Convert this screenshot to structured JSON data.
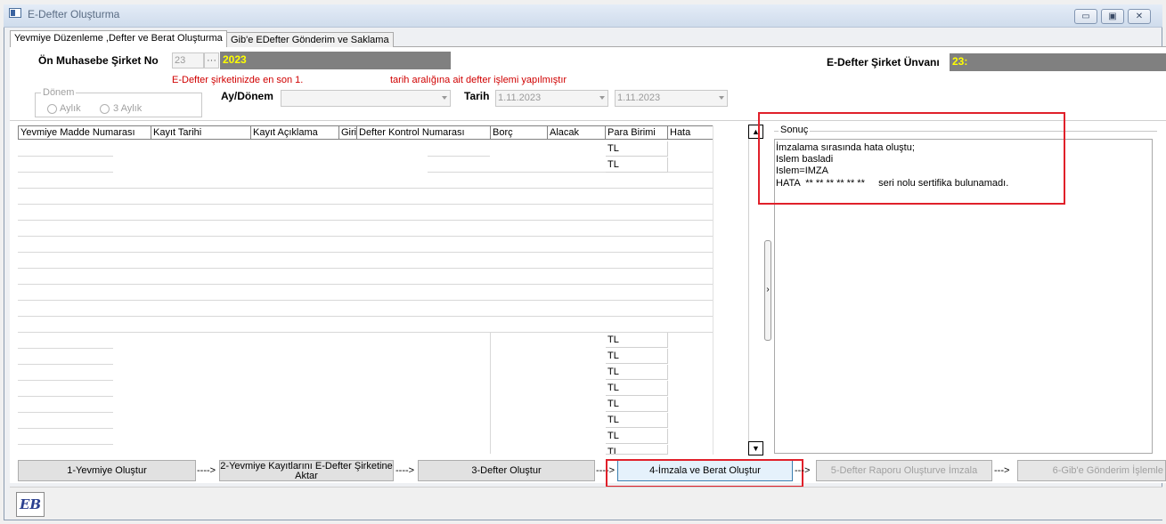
{
  "window": {
    "title": "E-Defter Oluşturma",
    "minimize": "▭",
    "maximize": "▣",
    "close": "✕"
  },
  "tabs": [
    {
      "label": "Yevmiye Düzenleme ,Defter ve Berat Oluşturma"
    },
    {
      "label": "Gib'e EDefter Gönderim ve Saklama"
    }
  ],
  "form": {
    "company_label": "Ön Muhasebe Şirket No",
    "company_no": "23",
    "browse": "···",
    "company_year": "2023",
    "edefter_company_label": "E-Defter Şirket Ünvanı",
    "edefter_company_value": "23:",
    "notice_left": "E-Defter şirketinizde en son 1.",
    "notice_right": "tarih aralığına ait defter işlemi yapılmıştır",
    "period_group": "Dönem",
    "period_monthly": "Aylık",
    "period_quarterly": "3 Aylık",
    "month_period_label": "Ay/Dönem",
    "month_period_value": "",
    "date_label": "Tarih",
    "date_from": "1.11.2023",
    "date_to": "1.11.2023"
  },
  "grid": {
    "columns": [
      "Yevmiye Madde Numarası",
      "Kayıt Tarihi",
      "Kayıt Açıklama",
      "Giri",
      "Defter Kontrol Numarası",
      "Borç",
      "Alacak",
      "Para Birimi",
      "Hata"
    ],
    "currency_top": [
      "TL",
      "TL"
    ],
    "currency_bottom": [
      "TL",
      "TL",
      "TL",
      "TL",
      "TL",
      "TL",
      "TL",
      "TL"
    ]
  },
  "result": {
    "label": "Sonuç",
    "lines": [
      "İmzalama sırasında hata oluştu;",
      "Islem basladi",
      "Islem=IMZA",
      "HATA  ** ** ** ** ** **     seri nolu sertifika bulunamadı."
    ]
  },
  "steps": {
    "s1": "1-Yevmiye Oluştur",
    "s2_line1": "2-Yevmiye Kayıtlarını E-Defter Şirketine",
    "s2_line2": "Aktar",
    "s3": "3-Defter Oluştur",
    "s4": "4-İmzala ve Berat Oluştur",
    "s5": "5-Defter Raporu Oluşturve İmzala",
    "s6": "6-Gib'e Gönderim İşlemle",
    "arrow": "---->",
    "arrow_short": "--->"
  },
  "logo": "EB",
  "scroll": {
    "up": "▲",
    "down": "▼",
    "splitter": "›"
  }
}
